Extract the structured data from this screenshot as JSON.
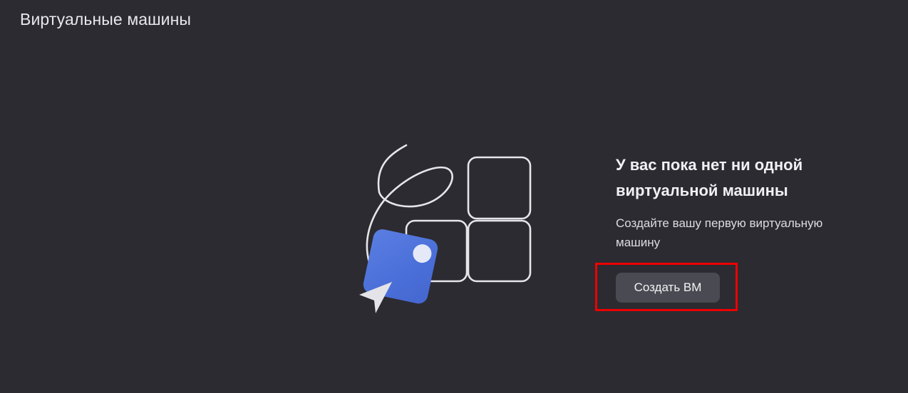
{
  "header": {
    "title": "Виртуальные машины"
  },
  "empty_state": {
    "heading": "У вас пока нет ни одной виртуальной машины",
    "subtitle": "Создайте вашу первую виртуальную машину",
    "create_button_label": "Создать ВМ"
  },
  "colors": {
    "background": "#2c2b31",
    "button_background": "#4a4a52",
    "highlight_border": "#ee0000",
    "illustration_accent": "#4a6fd8"
  },
  "icons": {
    "illustration": "vm-empty-state-illustration",
    "cursor": "cursor-arrow-icon"
  }
}
